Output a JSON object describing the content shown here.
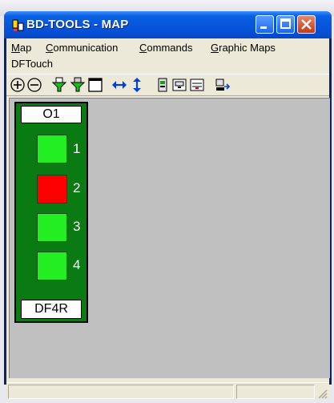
{
  "window": {
    "title": "BD-TOOLS - MAP"
  },
  "menu": {
    "items": [
      {
        "label": "Map",
        "accel": "M",
        "rest": "ap"
      },
      {
        "label": "Communication",
        "accel": "C",
        "rest": "ommunication"
      },
      {
        "label": "Commands",
        "accel": "C",
        "rest": "ommands"
      },
      {
        "label": "Graphic Maps",
        "accel": "G",
        "rest": "raphic Maps"
      },
      {
        "label": "DFTouch",
        "accel": "",
        "rest": "DFTouch"
      }
    ]
  },
  "toolbar": {
    "icons": [
      "zoom-in-icon",
      "zoom-out-icon",
      "filter-down-icon",
      "filter-down-alt-icon",
      "window-icon",
      "horizontal-arrows-icon",
      "vertical-arrows-icon",
      "device-icon",
      "panel-icon",
      "panel-alt-icon",
      "export-icon"
    ]
  },
  "panel": {
    "header": "O1",
    "footer": "DF4R",
    "indicators": [
      {
        "label": "1",
        "color": "#22ee22"
      },
      {
        "label": "2",
        "color": "#ff0000"
      },
      {
        "label": "3",
        "color": "#22ee22"
      },
      {
        "label": "4",
        "color": "#22ee22"
      }
    ]
  },
  "colors": {
    "titlebar": "#0554dc",
    "panel": "#0a7a12",
    "mdi_bg": "#c0c0c0"
  }
}
